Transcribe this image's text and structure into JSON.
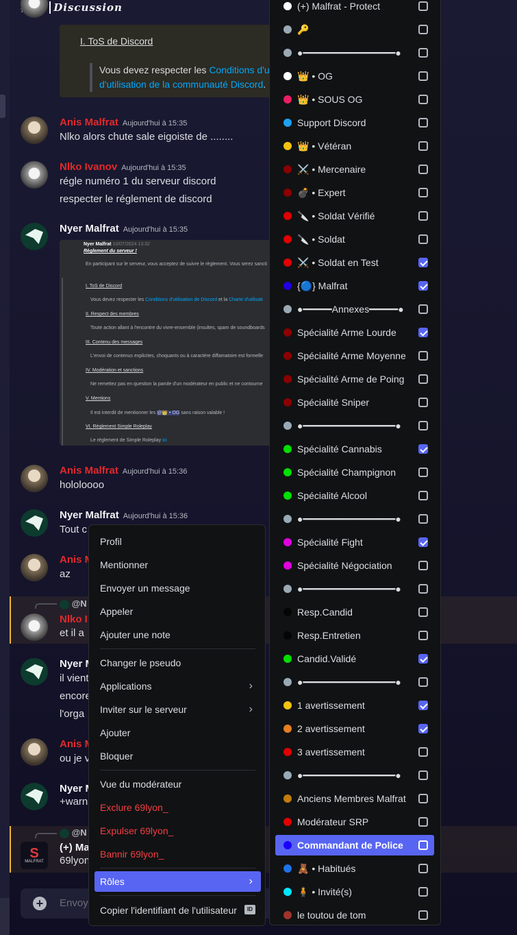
{
  "header": {
    "title": "Discussion"
  },
  "messages": [
    {
      "author": "Anis Malfrat",
      "time": "Aujourd'hui à 15:35",
      "lines": [
        "Nlko alors chute  sale eigoiste de ........"
      ]
    },
    {
      "author": "Nlko Ivanov",
      "time": "Aujourd'hui à 15:35",
      "lines": [
        "régle numéro 1 du serveur discord",
        "respecter le réglement de discord"
      ]
    },
    {
      "author": "Nyer Malfrat",
      "time": "Aujourd'hui à 15:35",
      "lines": []
    },
    {
      "author": "Anis Malfrat",
      "time": "Aujourd'hui à 15:36",
      "lines": [
        "hololoooo"
      ]
    },
    {
      "author": "Nyer Malfrat",
      "time": "Aujourd'hui à 15:36",
      "lines": [
        "Tout c"
      ]
    },
    {
      "author": "Anis M",
      "time": "",
      "lines": [
        "az"
      ]
    },
    {
      "author": "Nlko I",
      "time": "",
      "lines": [
        "et il a"
      ],
      "reply": "@N"
    },
    {
      "author": "Nyer M",
      "time": "",
      "lines": [
        "il vient",
        "encore",
        "l'orga"
      ]
    },
    {
      "author": "Anis M",
      "time": "",
      "lines": [
        "ou je v"
      ]
    },
    {
      "author": "Nyer M",
      "time": "",
      "lines": [
        "+warn"
      ]
    },
    {
      "author": "(+) Ma",
      "time": "",
      "lines": [
        "69lyon"
      ],
      "reply": "@N"
    }
  ],
  "embed": {
    "link_title": "I. ToS de Discord",
    "quote_prefix": "Vous devez respecter les ",
    "quote_link1": "Conditions d'uti",
    "quote_link2": "d'utilisation de la communauté Discord",
    "quote_suffix": "."
  },
  "screenshot": {
    "author": "Nyer Malfrat",
    "date": "10/07/2024 13:32",
    "heading": "Règlement du serveur !",
    "intro": "En participant sur le serveur, vous acceptez de suivre le règlement. Vous serez sancti",
    "s1": "I. ToS de Discord",
    "s1_text_a": "Vous devez respecter les ",
    "s1_link_a": "Conditions d'utilisation de Discord",
    "s1_text_b": " et la ",
    "s1_link_b": "Charte d'utilisati",
    "s2": "II. Respect des membres",
    "s2_text": "Toute action allant à l'encontre du vivre-ensemble (insultes, spam de soundboards",
    "s3": "III. Contenu des messages",
    "s3_text": "L'envoi de contenus explicites, choquants ou à caractère diffamatoire est formelle",
    "s4": "IV. Modération et sanctions",
    "s4_text": "Ne remettez pas en question la parole d'un modérateur en public et ne contourne",
    "s5": "V. Mentions",
    "s5_text_a": "Il est interdit de mentionner les ",
    "s5_role": "@👑 • OG",
    "s5_text_b": " sans raison valable !",
    "s6": "VI. Règlement Simple Roleplay",
    "s6_text": "Le règlement de Simple Roleplay ",
    "s6_link": "ici"
  },
  "composer": {
    "placeholder": "Envoy"
  },
  "context_menu": {
    "profile": "Profil",
    "mention": "Mentionner",
    "send_message": "Envoyer un message",
    "call": "Appeler",
    "add_note": "Ajouter une note",
    "change_nickname": "Changer le pseudo",
    "applications": "Applications",
    "invite": "Inviter sur le serveur",
    "add": "Ajouter",
    "block": "Bloquer",
    "mod_view": "Vue du modérateur",
    "exclude": "Exclure 69lyon_",
    "kick": "Expulser 69lyon_",
    "ban": "Bannir 69lyon_",
    "roles": "Rôles",
    "copy_id": "Copier l'identifiant de l'utilisateur",
    "id_badge": "ID"
  },
  "roles": [
    {
      "label": "(+) Malfrat - Protect",
      "color": "#ffffff",
      "checked": false
    },
    {
      "label": "🔑",
      "color": "#99aab5",
      "checked": false
    },
    {
      "label": "●━━━━━━━━━━━━━━━━●",
      "color": "#99aab5",
      "checked": false
    },
    {
      "label": "👑 • OG",
      "color": "#ffffff",
      "checked": false
    },
    {
      "label": "👑 • SOUS OG",
      "color": "#e91e63",
      "checked": false
    },
    {
      "label": "Support Discord",
      "color": "#1da1f2",
      "checked": false
    },
    {
      "label": "👑 • Vétéran",
      "color": "#f1c40f",
      "checked": false
    },
    {
      "label": "⚔️ • Mercenaire",
      "color": "#8b0000",
      "checked": false
    },
    {
      "label": "💣 • Expert",
      "color": "#8b0000",
      "checked": false
    },
    {
      "label": "🔪 • Soldat Vérifié",
      "color": "#e00000",
      "checked": false
    },
    {
      "label": "🔪 • Soldat",
      "color": "#e00000",
      "checked": false
    },
    {
      "label": "⚔️ • Soldat en Test",
      "color": "#e00000",
      "checked": true
    },
    {
      "label": "{🔵} Malfrat",
      "color": "#2000e0",
      "checked": true
    },
    {
      "label": "●━━━━━Annexes━━━━━●",
      "color": "#99aab5",
      "checked": false
    },
    {
      "label": "Spécialité Arme Lourde",
      "color": "#8b0000",
      "checked": true
    },
    {
      "label": "Spécialité Arme Moyenne",
      "color": "#8b0000",
      "checked": false
    },
    {
      "label": "Spécialité Arme de Poing",
      "color": "#8b0000",
      "checked": false
    },
    {
      "label": "Spécialité Sniper",
      "color": "#8b0000",
      "checked": false
    },
    {
      "label": "●━━━━━━━━━━━━━━━━●",
      "color": "#99aab5",
      "checked": false
    },
    {
      "label": "Spécialité Cannabis",
      "color": "#00e000",
      "checked": true
    },
    {
      "label": "Spécialité Champignon",
      "color": "#00e000",
      "checked": false
    },
    {
      "label": "Spécialité Alcool",
      "color": "#00e000",
      "checked": false
    },
    {
      "label": "●━━━━━━━━━━━━━━━━●",
      "color": "#99aab5",
      "checked": false
    },
    {
      "label": "Spécialité Fight",
      "color": "#e000e0",
      "checked": true
    },
    {
      "label": "Spécialité Négociation",
      "color": "#e000e0",
      "checked": false
    },
    {
      "label": "●━━━━━━━━━━━━━━━━●",
      "color": "#99aab5",
      "checked": false
    },
    {
      "label": "Resp.Candid",
      "color": "#050505",
      "checked": false
    },
    {
      "label": "Resp.Entretien",
      "color": "#050505",
      "checked": false
    },
    {
      "label": "Candid.Validé",
      "color": "#00e000",
      "checked": true
    },
    {
      "label": "●━━━━━━━━━━━━━━━━●",
      "color": "#99aab5",
      "checked": false
    },
    {
      "label": "1 avertissement",
      "color": "#f1c40f",
      "checked": true
    },
    {
      "label": "2 avertissement",
      "color": "#e67e22",
      "checked": true
    },
    {
      "label": "3 avertissement",
      "color": "#e00000",
      "checked": false
    },
    {
      "label": "●━━━━━━━━━━━━━━━━●",
      "color": "#99aab5",
      "checked": false
    },
    {
      "label": "Anciens Membres Malfrat",
      "color": "#c27c0e",
      "checked": false
    },
    {
      "label": "Modérateur SRP",
      "color": "#e00000",
      "checked": false
    },
    {
      "label": "Commandant de Police",
      "color": "#1a00ff",
      "checked": false,
      "active": true
    },
    {
      "label": "🧸 • Habitués",
      "color": "#1e73e8",
      "checked": false
    },
    {
      "label": "🧍 • Invité(s)",
      "color": "#00e5ff",
      "checked": false
    },
    {
      "label": "le toutou de tom",
      "color": "#a0342a",
      "checked": false
    }
  ],
  "colors": {
    "accent": "#5865f2",
    "danger": "#f23f42",
    "username_red": "#e02a2a",
    "link": "#00a8fc"
  }
}
